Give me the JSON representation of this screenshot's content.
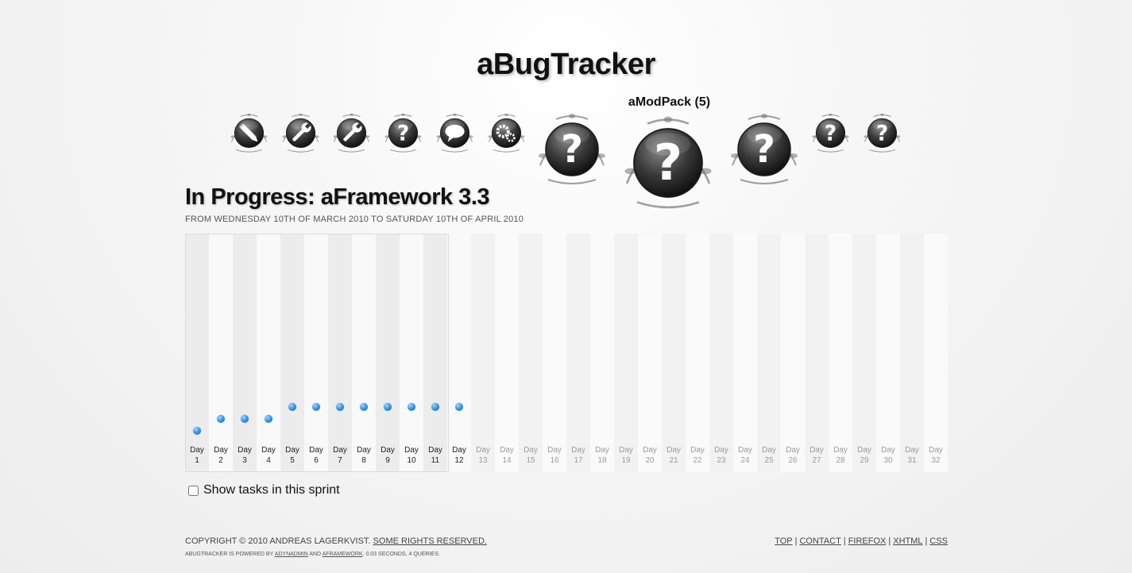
{
  "header": {
    "site_title": "aBugTracker",
    "active_project_label": "aModPack (5)"
  },
  "project_icons": [
    {
      "name": "pencil-icon",
      "symbol": "pencil"
    },
    {
      "name": "wrench-icon",
      "symbol": "wrench"
    },
    {
      "name": "wrench-icon",
      "symbol": "wrench"
    },
    {
      "name": "question-icon",
      "symbol": "question"
    },
    {
      "name": "speech-bubble-icon",
      "symbol": "speech"
    },
    {
      "name": "gears-icon",
      "symbol": "gears"
    },
    {
      "name": "question-icon",
      "symbol": "question"
    },
    {
      "name": "question-icon",
      "symbol": "question",
      "active": true
    },
    {
      "name": "question-icon",
      "symbol": "question"
    },
    {
      "name": "question-icon",
      "symbol": "question"
    },
    {
      "name": "question-icon",
      "symbol": "question"
    }
  ],
  "sprint": {
    "title": "In Progress: aFramework 3.3",
    "range": "From Wednesday 10th of March 2010 to Saturday 10th of April 2010"
  },
  "chart_data": {
    "type": "scatter",
    "day_word": "Day",
    "days": [
      1,
      2,
      3,
      4,
      5,
      6,
      7,
      8,
      9,
      10,
      11,
      12,
      13,
      14,
      15,
      16,
      17,
      18,
      19,
      20,
      21,
      22,
      23,
      24,
      25,
      26,
      27,
      28,
      29,
      30,
      31,
      32
    ],
    "elapsed_days": 12,
    "values": [
      0,
      1,
      1,
      1,
      2,
      2,
      2,
      2,
      2,
      2,
      2,
      2
    ],
    "ylim": [
      0,
      20
    ],
    "point_color": "#2b8fe8"
  },
  "toggle": {
    "label": "Show tasks in this sprint",
    "checked": false
  },
  "footer": {
    "copyright": "Copyright © 2010 Andreas Lagerkvist.",
    "rights_link": "Some rights reserved.",
    "powered_prefix": "aBugTracker is powered by",
    "powered_link1": "aDynAdmin",
    "powered_and": "and",
    "powered_link2": "aFramework",
    "powered_suffix": ". 0.03 seconds, 4 queries.",
    "links": [
      "Top",
      "Contact",
      "Firefox",
      "XHTML",
      "CSS"
    ]
  }
}
